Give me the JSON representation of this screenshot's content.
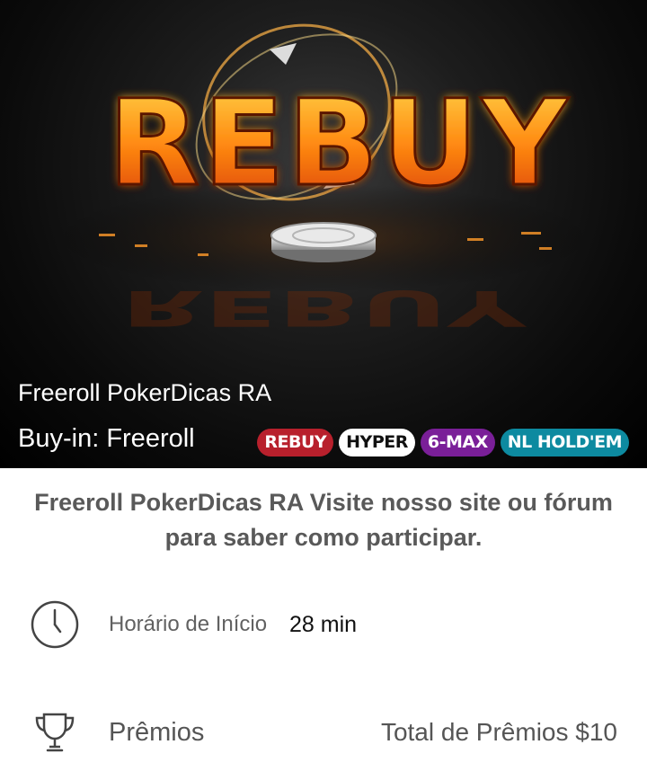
{
  "banner": {
    "art_text": "REBUY",
    "tournament_name": "Freeroll PokerDicas RA",
    "buyin_text": "Buy-in: Freeroll",
    "tags": [
      {
        "label": "REBUY",
        "color": "#b8202c"
      },
      {
        "label": "HYPER",
        "color": "#ffffff"
      },
      {
        "label": "6-MAX",
        "color": "#7a1f98"
      },
      {
        "label": "NL HOLD'EM",
        "color": "#0d8aa0"
      }
    ]
  },
  "description": "Freeroll PokerDicas RA  Visite nosso site ou fórum para saber como participar.",
  "start": {
    "icon": "clock-icon",
    "label": "Horário de Início",
    "value": "28 min"
  },
  "prizes": {
    "icon": "trophy-icon",
    "label": "Prêmios",
    "total": "Total de Prêmios $10"
  },
  "colors": {
    "banner_bg": "#000000",
    "text_gray": "#595959"
  }
}
